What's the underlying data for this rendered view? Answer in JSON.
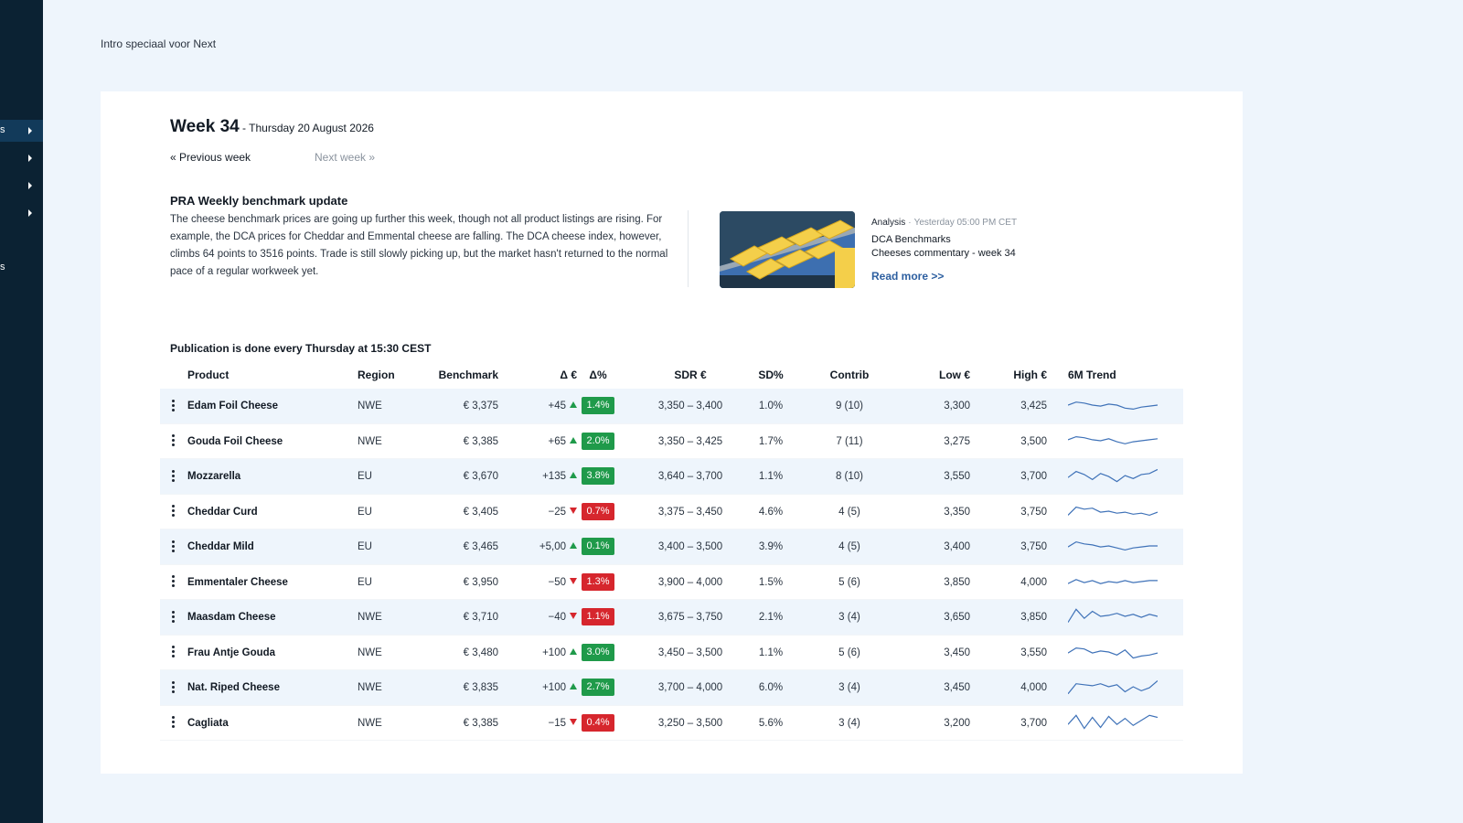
{
  "sidebar": {
    "items": [
      {
        "label": "s",
        "chevron": "chevron-right-icon",
        "active": true
      },
      {
        "label": "",
        "chevron": "chevron-right-icon",
        "active": false
      },
      {
        "label": "",
        "chevron": "chevron-right-icon",
        "active": false
      },
      {
        "label": "",
        "chevron": "chevron-right-icon",
        "active": false
      },
      {
        "label": "s",
        "chevron": null,
        "active": false
      }
    ]
  },
  "intro": "Intro speciaal voor Next",
  "week": {
    "title": "Week 34",
    "date": " - Thursday 20 August 2026",
    "prev_label": "« Previous week",
    "next_label": "Next week »"
  },
  "article": {
    "title": "PRA Weekly benchmark update",
    "body": "The cheese benchmark prices are going up further this week, though not all product listings are rising. For example, the DCA prices for Cheddar and Emmental cheese are falling. The DCA cheese index, however, climbs 64 points to 3516 points. Trade is still slowly picking up, but the market hasn't returned to the normal pace of a regular workweek yet."
  },
  "news": {
    "category": "Analysis",
    "separator": "·",
    "time": "Yesterday 05:00 PM CET",
    "line1": "DCA Benchmarks",
    "line2": "Cheeses commentary - week 34",
    "read_more": "Read more >>",
    "image": "cheese-conveyor-photo"
  },
  "publication_note": "Publication is done every Thursday at 15:30 CEST",
  "colors": {
    "sidebar_bg": "#0b2233",
    "up": "#1f9a4a",
    "down": "#d6262d",
    "link": "#2d5fa0",
    "sparkline": "#3f72b8",
    "row_alt": "#eef5fc"
  },
  "table": {
    "headers": {
      "product": "Product",
      "region": "Region",
      "benchmark": "Benchmark",
      "delta_eur": "Δ €",
      "delta_pct": "Δ%",
      "sdr": "SDR €",
      "sd_pct": "SD%",
      "contrib": "Contrib",
      "low": "Low €",
      "high": "High €",
      "trend": "6M Trend"
    },
    "rows": [
      {
        "product": "Edam Foil Cheese",
        "region": "NWE",
        "benchmark": "€ 3,375",
        "delta_eur": "+45",
        "dir": "up",
        "delta_pct": "1.4%",
        "sdr": "3,350 – 3,400",
        "sd_pct": "1.0%",
        "contrib": "9 (10)",
        "low": "3,300",
        "high": "3,425",
        "trend": [
          0.5,
          0.65,
          0.6,
          0.5,
          0.45,
          0.55,
          0.5,
          0.35,
          0.3,
          0.4,
          0.45,
          0.5
        ]
      },
      {
        "product": "Gouda Foil Cheese",
        "region": "NWE",
        "benchmark": "€ 3,385",
        "delta_eur": "+65",
        "dir": "up",
        "delta_pct": "2.0%",
        "sdr": "3,350 – 3,425",
        "sd_pct": "1.7%",
        "contrib": "7 (11)",
        "low": "3,275",
        "high": "3,500",
        "trend": [
          0.55,
          0.7,
          0.65,
          0.55,
          0.5,
          0.6,
          0.45,
          0.35,
          0.45,
          0.5,
          0.55,
          0.6
        ]
      },
      {
        "product": "Mozzarella",
        "region": "EU",
        "benchmark": "€ 3,670",
        "delta_eur": "+135",
        "dir": "up",
        "delta_pct": "3.8%",
        "sdr": "3,640 – 3,700",
        "sd_pct": "1.1%",
        "contrib": "8 (10)",
        "low": "3,550",
        "high": "3,700",
        "trend": [
          0.4,
          0.7,
          0.55,
          0.3,
          0.6,
          0.45,
          0.2,
          0.5,
          0.35,
          0.55,
          0.6,
          0.8
        ]
      },
      {
        "product": "Cheddar Curd",
        "region": "EU",
        "benchmark": "€ 3,405",
        "delta_eur": "−25",
        "dir": "down",
        "delta_pct": "0.7%",
        "sdr": "3,375 – 3,450",
        "sd_pct": "4.6%",
        "contrib": "4 (5)",
        "low": "3,350",
        "high": "3,750",
        "trend": [
          0.3,
          0.7,
          0.6,
          0.65,
          0.45,
          0.5,
          0.4,
          0.45,
          0.35,
          0.4,
          0.3,
          0.45
        ]
      },
      {
        "product": "Cheddar Mild",
        "region": "EU",
        "benchmark": "€ 3,465",
        "delta_eur": "+5,00",
        "dir": "up",
        "delta_pct": "0.1%",
        "sdr": "3,400 – 3,500",
        "sd_pct": "3.9%",
        "contrib": "4 (5)",
        "low": "3,400",
        "high": "3,750",
        "trend": [
          0.45,
          0.7,
          0.6,
          0.55,
          0.45,
          0.5,
          0.4,
          0.3,
          0.4,
          0.45,
          0.5,
          0.5
        ]
      },
      {
        "product": "Emmentaler Cheese",
        "region": "EU",
        "benchmark": "€ 3,950",
        "delta_eur": "−50",
        "dir": "down",
        "delta_pct": "1.3%",
        "sdr": "3,900 – 4,000",
        "sd_pct": "1.5%",
        "contrib": "5 (6)",
        "low": "3,850",
        "high": "4,000",
        "trend": [
          0.4,
          0.6,
          0.45,
          0.55,
          0.4,
          0.5,
          0.45,
          0.55,
          0.45,
          0.5,
          0.55,
          0.55
        ]
      },
      {
        "product": "Maasdam Cheese",
        "region": "NWE",
        "benchmark": "€ 3,710",
        "delta_eur": "−40",
        "dir": "down",
        "delta_pct": "1.1%",
        "sdr": "3,675 – 3,750",
        "sd_pct": "2.1%",
        "contrib": "3 (4)",
        "low": "3,650",
        "high": "3,850",
        "trend": [
          0.2,
          0.85,
          0.4,
          0.75,
          0.5,
          0.55,
          0.65,
          0.5,
          0.6,
          0.45,
          0.6,
          0.5
        ]
      },
      {
        "product": "Frau Antje Gouda",
        "region": "NWE",
        "benchmark": "€ 3,480",
        "delta_eur": "+100",
        "dir": "up",
        "delta_pct": "3.0%",
        "sdr": "3,450 – 3,500",
        "sd_pct": "1.1%",
        "contrib": "5 (6)",
        "low": "3,450",
        "high": "3,550",
        "trend": [
          0.45,
          0.7,
          0.65,
          0.45,
          0.55,
          0.5,
          0.35,
          0.6,
          0.2,
          0.3,
          0.35,
          0.45
        ]
      },
      {
        "product": "Nat. Riped Cheese",
        "region": "NWE",
        "benchmark": "€ 3,835",
        "delta_eur": "+100",
        "dir": "up",
        "delta_pct": "2.7%",
        "sdr": "3,700 – 4,000",
        "sd_pct": "6.0%",
        "contrib": "3 (4)",
        "low": "3,450",
        "high": "4,000",
        "trend": [
          0.15,
          0.65,
          0.6,
          0.55,
          0.65,
          0.5,
          0.6,
          0.25,
          0.5,
          0.3,
          0.45,
          0.8
        ]
      },
      {
        "product": "Cagliata",
        "region": "NWE",
        "benchmark": "€ 3,385",
        "delta_eur": "−15",
        "dir": "down",
        "delta_pct": "0.4%",
        "sdr": "3,250 – 3,500",
        "sd_pct": "5.6%",
        "contrib": "3 (4)",
        "low": "3,200",
        "high": "3,700",
        "trend": [
          0.4,
          0.85,
          0.2,
          0.75,
          0.25,
          0.8,
          0.4,
          0.7,
          0.35,
          0.6,
          0.85,
          0.75
        ]
      }
    ]
  }
}
